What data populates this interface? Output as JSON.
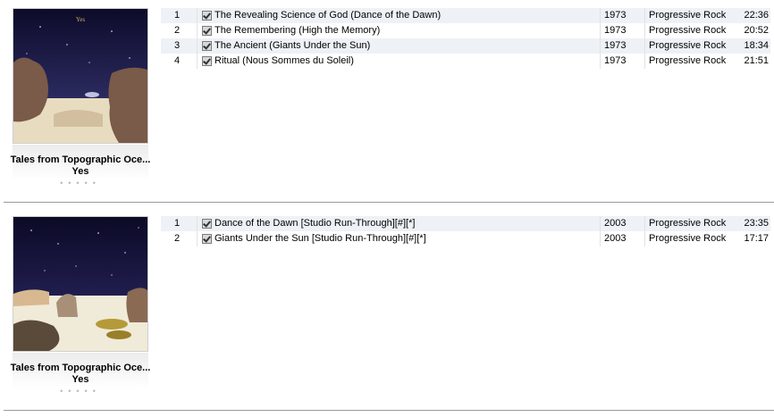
{
  "albums": [
    {
      "title": "Tales from Topographic Oce...",
      "artist": "Yes",
      "rating": "•••••",
      "cover_colors": {
        "sky_top": "#0d0b2a",
        "sky_bottom": "#3a3a7a",
        "sand": "#e8dcc0",
        "rock": "#7a5a48"
      },
      "tracks": [
        {
          "num": "1",
          "name": "The Revealing Science of God  (Dance of the Dawn)",
          "year": "1973",
          "genre": "Progressive Rock",
          "time": "22:36"
        },
        {
          "num": "2",
          "name": "The Remembering  (High the Memory)",
          "year": "1973",
          "genre": "Progressive Rock",
          "time": "20:52"
        },
        {
          "num": "3",
          "name": "The Ancient  (Giants Under the Sun)",
          "year": "1973",
          "genre": "Progressive Rock",
          "time": "18:34"
        },
        {
          "num": "4",
          "name": "Ritual  (Nous Sommes du Soleil)",
          "year": "1973",
          "genre": "Progressive Rock",
          "time": "21:51"
        }
      ]
    },
    {
      "title": "Tales from Topographic Oce...",
      "artist": "Yes",
      "rating": "•••••",
      "cover_colors": {
        "sky_top": "#0c0a26",
        "sky_bottom": "#2e2c6a",
        "sand": "#f0ead8",
        "rock": "#8a6a52"
      },
      "tracks": [
        {
          "num": "1",
          "name": "Dance of the Dawn [Studio Run-Through][#][*]",
          "year": "2003",
          "genre": "Progressive Rock",
          "time": "23:35"
        },
        {
          "num": "2",
          "name": "Giants Under the Sun [Studio Run-Through][#][*]",
          "year": "2003",
          "genre": "Progressive Rock",
          "time": "17:17"
        }
      ]
    }
  ]
}
